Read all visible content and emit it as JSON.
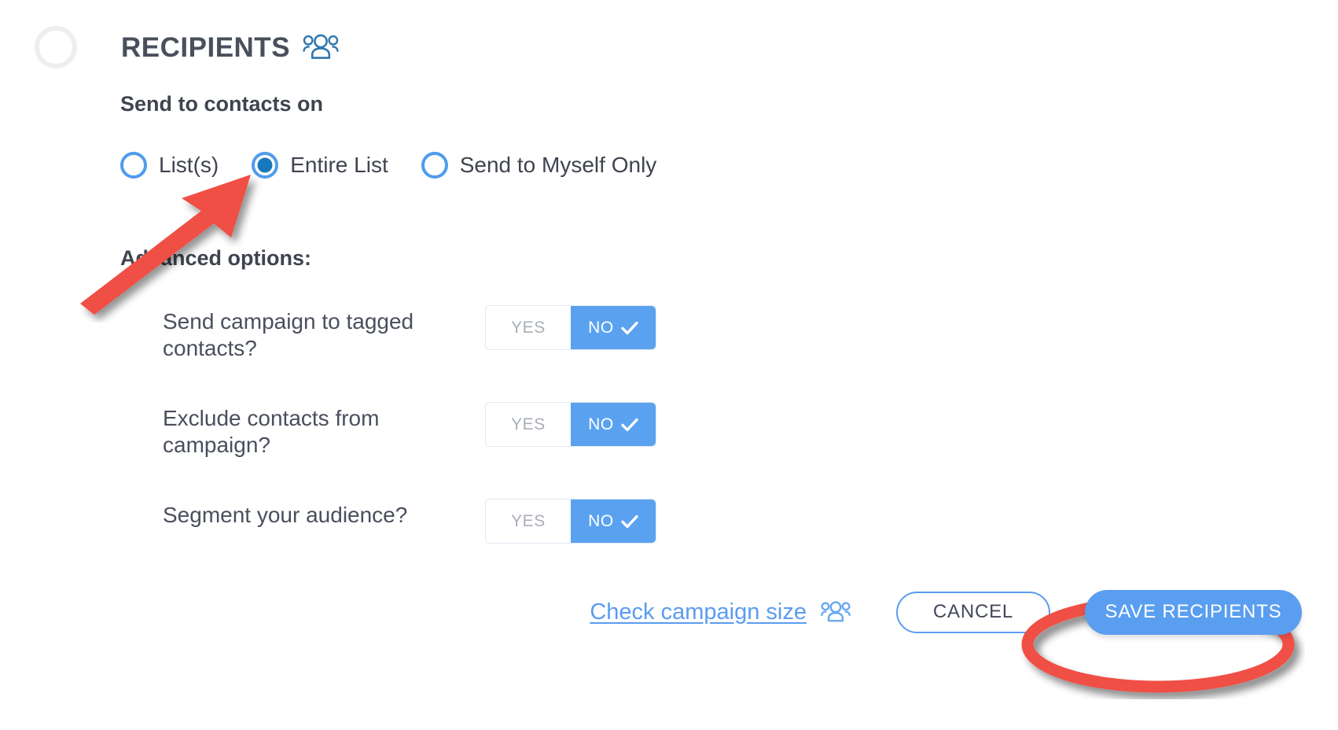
{
  "section": {
    "title": "RECIPIENTS",
    "title_icon": "people-group-icon",
    "step_indicator": "step-circle-empty"
  },
  "form": {
    "subhead": "Send to contacts on",
    "advanced_label": "Advanced options:",
    "radio_options": [
      {
        "label": "List(s)",
        "selected": false
      },
      {
        "label": "Entire List",
        "selected": true
      },
      {
        "label": "Send to Myself Only",
        "selected": false
      }
    ],
    "toggle_labels": {
      "yes": "YES",
      "no": "NO"
    },
    "options": [
      {
        "question": "Send campaign to tagged contacts?",
        "value": "NO"
      },
      {
        "question": "Exclude contacts from campaign?",
        "value": "NO"
      },
      {
        "question": "Segment your audience?",
        "value": "NO"
      }
    ]
  },
  "footer": {
    "check_link": "Check campaign size",
    "check_link_icon": "people-group-icon",
    "cancel_label": "CANCEL",
    "save_label": "SAVE RECIPIENTS"
  },
  "annotations": {
    "arrow": "red-arrow-pointing-to-entire-list-radio",
    "ellipse": "red-ellipse-around-save-recipients-button"
  },
  "colors": {
    "accent_blue": "#5a9ef0",
    "radio_blue": "#4f9cec",
    "radio_dot": "#1779bc",
    "icon_blue": "#2e77ae",
    "text_dark": "#3f444f",
    "annotation_red": "#ef4f44",
    "toggle_off_text": "#a9aeb5"
  }
}
